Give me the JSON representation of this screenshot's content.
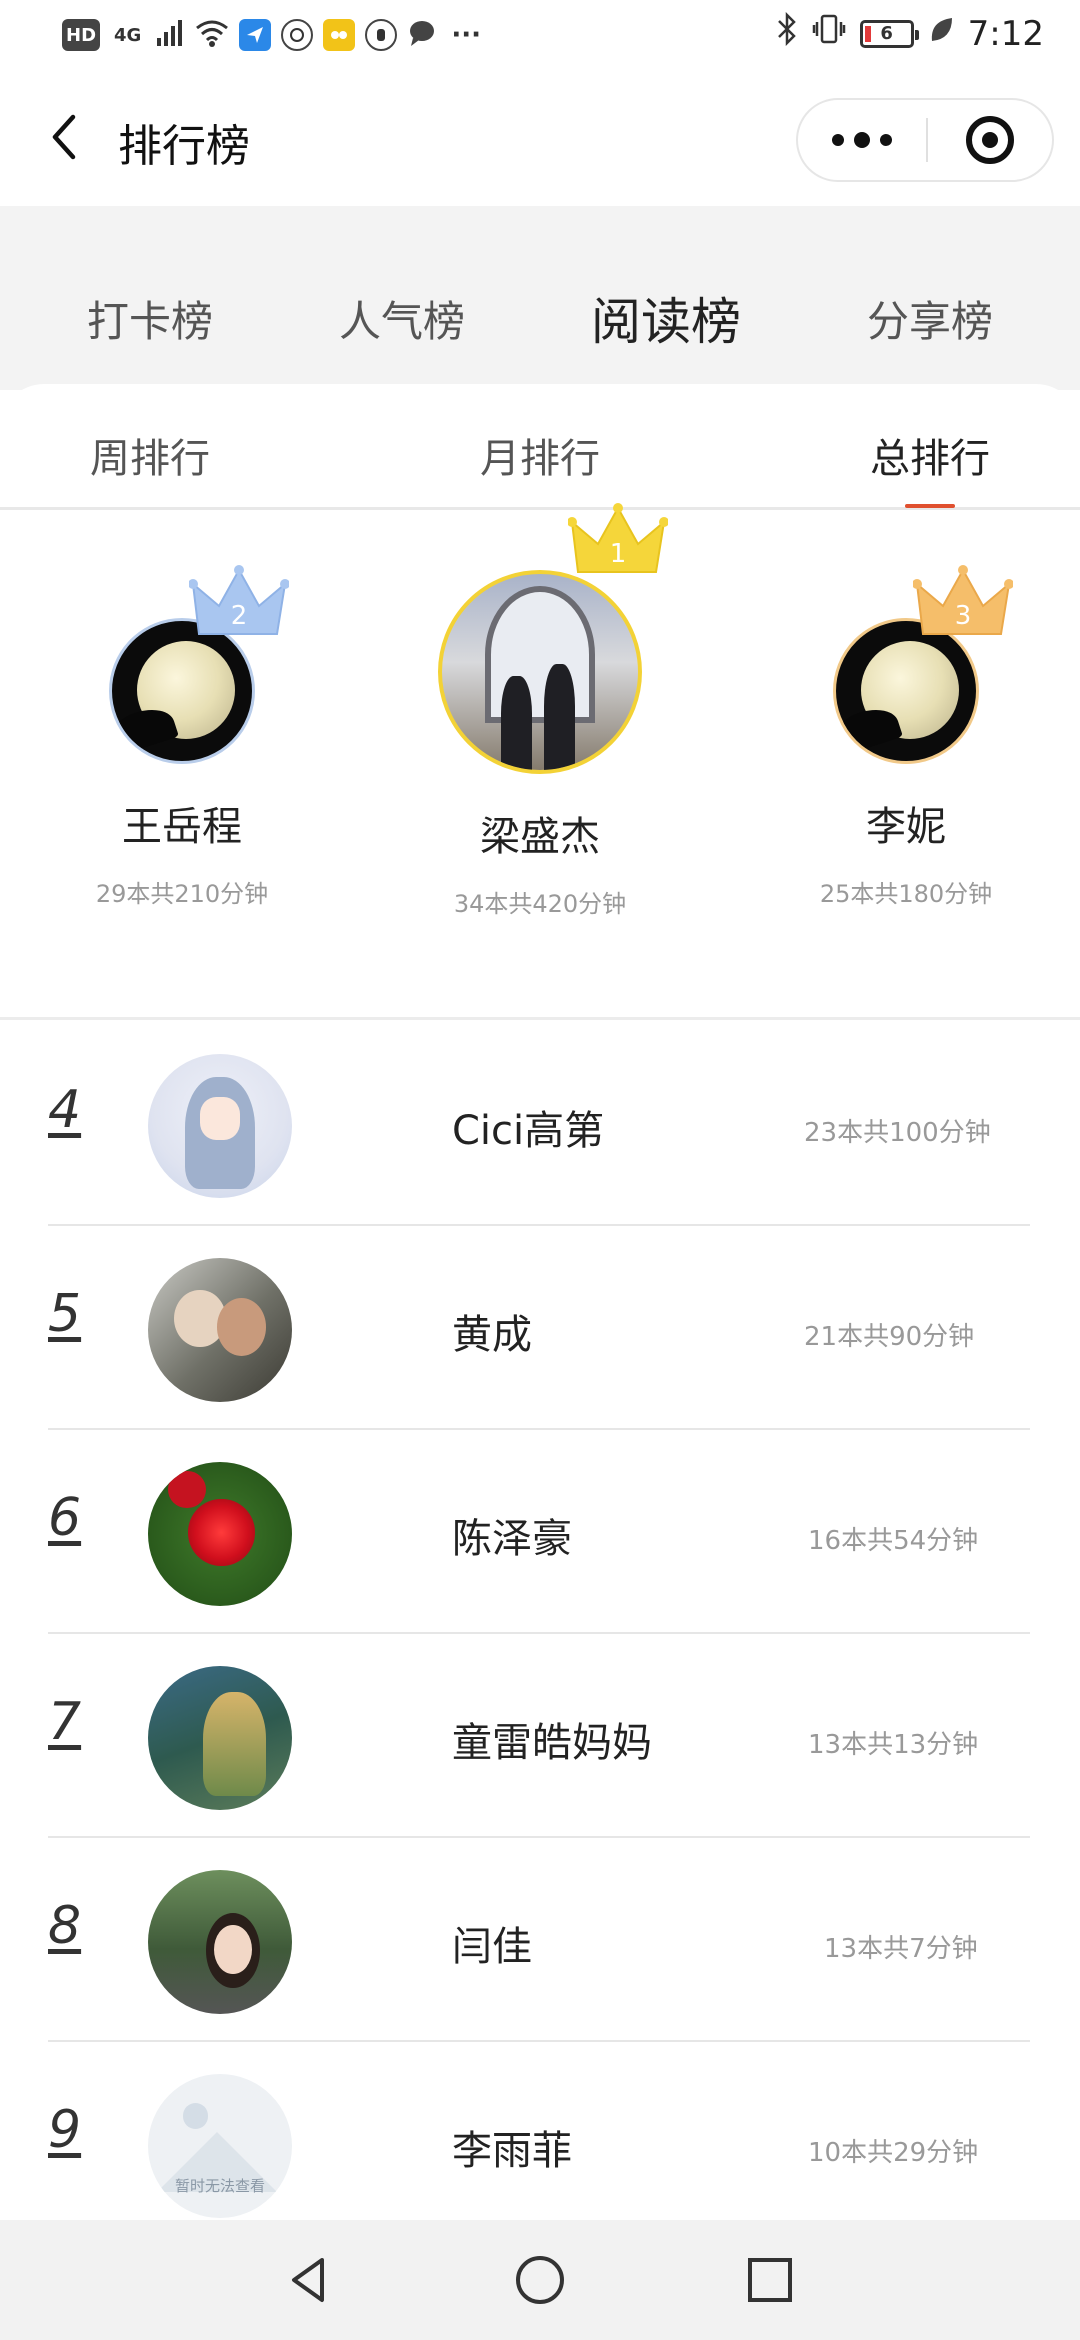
{
  "status_bar": {
    "left_icons": [
      "HD",
      "4G",
      "signal-icon",
      "wifi-icon",
      "send-icon",
      "browser-icon",
      "app-icon",
      "hand-icon",
      "chat-icon",
      "more-icon"
    ],
    "hd_label": "HD",
    "network_label": "4G",
    "more_label": "···",
    "battery_level": "6",
    "time": "7:12"
  },
  "nav": {
    "title": "排行榜"
  },
  "main_tabs": [
    {
      "label": "打卡榜",
      "active": false
    },
    {
      "label": "人气榜",
      "active": false
    },
    {
      "label": "阅读榜",
      "active": true
    },
    {
      "label": "分享榜",
      "active": false
    }
  ],
  "sub_tabs": [
    {
      "label": "周排行",
      "active": false
    },
    {
      "label": "月排行",
      "active": false
    },
    {
      "label": "总排行",
      "active": true
    }
  ],
  "podium": [
    {
      "rank": "2",
      "name": "王岳程",
      "stat": "29本共210分钟",
      "crown_color": "#a9c6f0"
    },
    {
      "rank": "1",
      "name": "梁盛杰",
      "stat": "34本共420分钟",
      "crown_color": "#f5d63a"
    },
    {
      "rank": "3",
      "name": "李妮",
      "stat": "25本共180分钟",
      "crown_color": "#f5be6a"
    }
  ],
  "list": [
    {
      "rank": "4",
      "name": "Cici高第",
      "stat": "23本共100分钟"
    },
    {
      "rank": "5",
      "name": "黄成",
      "stat": "21本共90分钟"
    },
    {
      "rank": "6",
      "name": "陈泽豪",
      "stat": "16本共54分钟"
    },
    {
      "rank": "7",
      "name": "童雷皓妈妈",
      "stat": "13本共13分钟"
    },
    {
      "rank": "8",
      "name": "闫佳",
      "stat": "13本共7分钟"
    },
    {
      "rank": "9",
      "name": "李雨菲",
      "stat": "10本共29分钟",
      "avatar_placeholder": "暂时无法查看"
    }
  ],
  "colors": {
    "accent": "#e0502f",
    "gray_bg": "#f3f3f3"
  }
}
